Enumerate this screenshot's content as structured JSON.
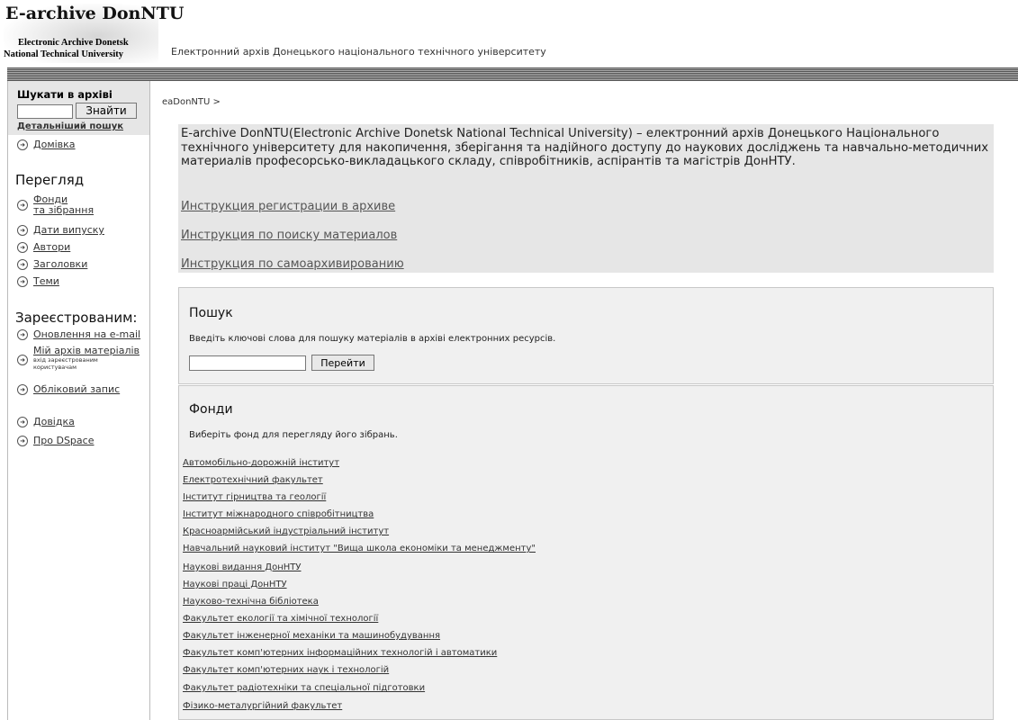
{
  "header": {
    "logo_title": "E-archive DonNTU",
    "logo_subtitle_line1": "Electronic Archive Donetsk",
    "logo_subtitle_line2": "National Technical University",
    "tagline": "Електронний архів Донецького національного технічного університету"
  },
  "sidebar": {
    "search_label": "Шукати в архіві",
    "search_button": "Знайти",
    "advanced_search": "Детальніший пошук",
    "home": "Домівка",
    "browse_heading": "Перегляд",
    "browse_items": [
      "Фонди",
      "та зібрання",
      "Дати випуску",
      "Автори",
      "Заголовки",
      "Теми"
    ],
    "registered_heading": "Зареєстрованим:",
    "registered_items": {
      "updates": "Оновлення на e-mail",
      "my_archive": "Мій архів матеріалів",
      "note_line1": "вхід зареєстрованим",
      "note_line2": "користувачам",
      "account": "Обліковий запис"
    },
    "help": "Довідка",
    "about": "Про DSpace"
  },
  "main": {
    "breadcrumb": "eaDonNTU >",
    "intro_text": "E-archive DonNTU(Electronic Archive Donetsk National Technical University) – електронний архів Донецького Національного технічного університету для накопичення, зберігання та надійного доступу до наукових досліджень та навчально-методичних материалів професорсько-викладацького складу, співробітників, аспірантів та магістрів ДонНТУ.",
    "intro_links": [
      "Инструкция регистрации в архиве",
      "Инструкция по поиску материалов",
      "Инструкция по самоархивированию"
    ],
    "search_panel": {
      "title": "Пошук",
      "description": "Введіть ключові слова для пошуку матеріалів в архіві електронних ресурсів.",
      "button": "Перейти"
    },
    "communities_panel": {
      "title": "Фонди",
      "description": "Виберіть фонд для перегляду його зібрань.",
      "items": [
        "Автомобільно-дорожній інститут",
        "Електротехнічний факультет",
        "Інститут гірництва та геології",
        "Інститут міжнародного співробітництва",
        "Красноармійський індустріальний інститут",
        "Навчальний науковий інститут \"Вища школа економіки та менеджменту\"",
        "Наукові видання ДонНТУ",
        "Наукові праці ДонНТУ",
        "Науково-технічна бібліотека",
        "Факультет екології та хімічної технології",
        "Факультет інженерної механіки та машинобудування",
        "Факультет комп'ютерних інформаційних технологій і автоматики",
        "Факультет комп'ютерних наук і технологій",
        "Факультет радіотехніки та спеціальної підготовки",
        "Фізико-металургійний факультет"
      ]
    }
  }
}
